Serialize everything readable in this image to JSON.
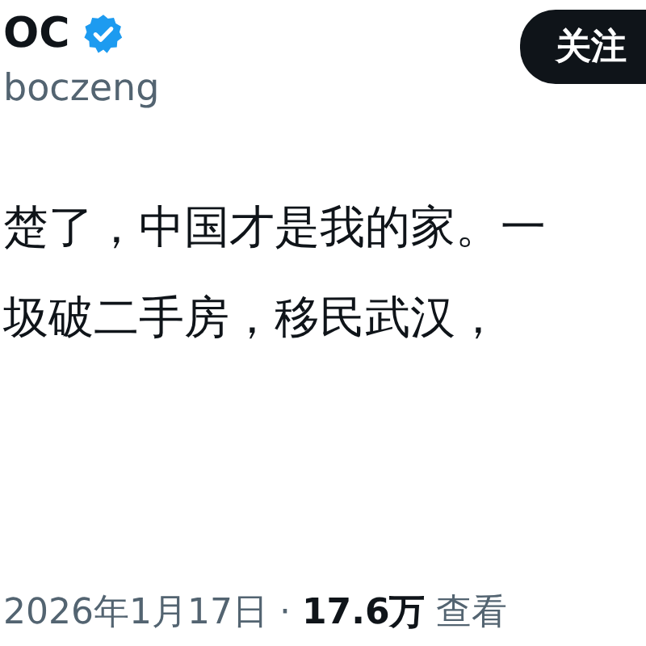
{
  "author": {
    "name": "OC",
    "verified": true,
    "handle": "boczeng"
  },
  "follow_button": {
    "label": "关注"
  },
  "post": {
    "lines": [
      "楚了，中国才是我的家。一",
      "圾破二手房，移民武汉，"
    ]
  },
  "meta": "2026年1月17日 · **17.6万** 查看"
}
